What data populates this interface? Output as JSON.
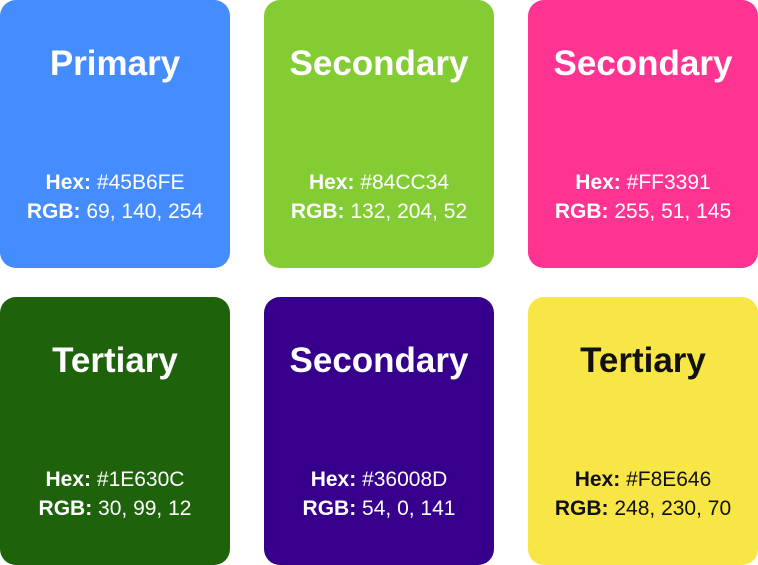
{
  "hex_label": "Hex:",
  "rgb_label": "RGB:",
  "swatches": [
    {
      "name": "Primary",
      "hex": "#45B6FE",
      "rgb": "69, 140, 254",
      "bg": "#458CFE",
      "fg": "#FFFFFF"
    },
    {
      "name": "Secondary",
      "hex": "#84CC34",
      "rgb": "132, 204, 52",
      "bg": "#84CC34",
      "fg": "#FFFFFF"
    },
    {
      "name": "Secondary",
      "hex": "#FF3391",
      "rgb": "255, 51, 145",
      "bg": "#FF3391",
      "fg": "#FFFFFF"
    },
    {
      "name": "Tertiary",
      "hex": "#1E630C",
      "rgb": "30, 99, 12",
      "bg": "#1E630C",
      "fg": "#FFFFFF"
    },
    {
      "name": "Secondary",
      "hex": "#36008D",
      "rgb": "54, 0, 141",
      "bg": "#36008D",
      "fg": "#FFFFFF"
    },
    {
      "name": "Tertiary",
      "hex": "#F8E646",
      "rgb": "248, 230, 70",
      "bg": "#F8E646",
      "fg": "#111111"
    }
  ]
}
